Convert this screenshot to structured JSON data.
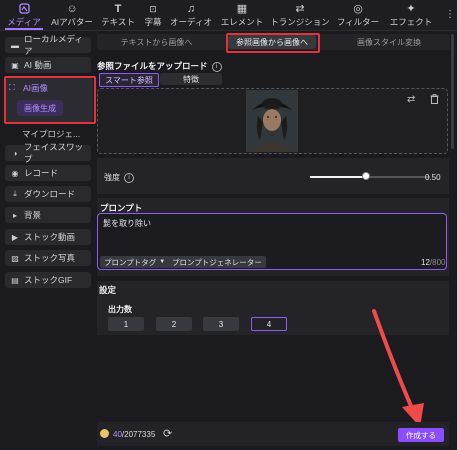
{
  "toolbar": {
    "items": [
      {
        "label": "メディア",
        "icon": "media-icon",
        "active": true
      },
      {
        "label": "AIアバター",
        "icon": "ai-avatar-icon"
      },
      {
        "label": "テキスト",
        "icon": "text-icon"
      },
      {
        "label": "字幕",
        "icon": "subtitle-icon"
      },
      {
        "label": "オーディオ",
        "icon": "audio-icon"
      },
      {
        "label": "エレメント",
        "icon": "element-icon"
      },
      {
        "label": "トランジション",
        "icon": "transition-icon"
      },
      {
        "label": "フィルター",
        "icon": "filter-icon"
      },
      {
        "label": "エフェクト",
        "icon": "effect-icon"
      }
    ]
  },
  "sidebar": {
    "items": [
      {
        "label": "ローカルメディア",
        "icon": "folder-icon"
      },
      {
        "label": "AI 動画",
        "icon": "ai-video-icon"
      },
      {
        "label": "AI画像",
        "icon": "ai-image-icon"
      },
      {
        "label": "画像生成"
      },
      {
        "label": "マイプロジェ..."
      },
      {
        "label": "フェイススワップ",
        "icon": "face-swap-icon"
      },
      {
        "label": "レコード",
        "icon": "record-icon"
      },
      {
        "label": "ダウンロード",
        "icon": "download-icon"
      },
      {
        "label": "背景",
        "icon": "background-icon"
      },
      {
        "label": "ストック動画",
        "icon": "stock-video-icon"
      },
      {
        "label": "ストック写真",
        "icon": "stock-photo-icon"
      },
      {
        "label": "ストックGIF",
        "icon": "stock-gif-icon"
      }
    ]
  },
  "main": {
    "tabs": [
      {
        "label": "テキストから画像へ"
      },
      {
        "label": "参照画像から画像へ",
        "selected": true
      },
      {
        "label": "画像スタイル変換"
      }
    ],
    "upload": {
      "title": "参照ファイルをアップロード",
      "subtabs": [
        {
          "label": "スマート参照",
          "selected": true
        },
        {
          "label": "特徴"
        }
      ]
    },
    "strength": {
      "label": "強度",
      "value": "0.50",
      "level": 0.5
    },
    "prompt": {
      "title": "プロンプト",
      "text": "髭を取り除い",
      "tag_chip": "プロンプトタグ",
      "generator_chip": "プロンプトジェネレーター",
      "count": "12",
      "max": "/800"
    },
    "settings": {
      "title": "設定",
      "output_label": "出力数",
      "options": [
        "1",
        "2",
        "3",
        "4"
      ],
      "selected": "4"
    }
  },
  "footer": {
    "credits_used": "40",
    "credits_total": "/2077335",
    "create_label": "作成する"
  },
  "colors": {
    "accent": "#8a4dff",
    "highlight_box": "#e0343a",
    "arrow": "#f04b4b"
  }
}
